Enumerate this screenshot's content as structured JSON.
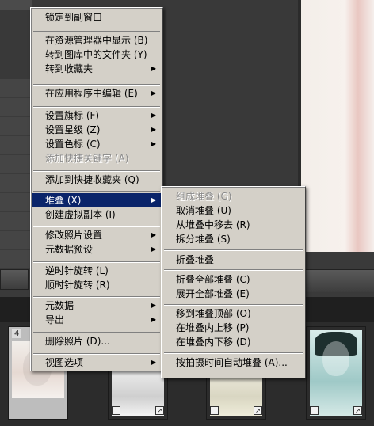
{
  "filmstrip": {
    "selected_index": "4"
  },
  "context_menu": {
    "items": [
      {
        "label": "锁定到副窗口",
        "has_submenu": false,
        "enabled": true
      },
      {
        "label": "在资源管理器中显示 (B)",
        "has_submenu": false,
        "enabled": true
      },
      {
        "label": "转到图库中的文件夹 (Y)",
        "has_submenu": false,
        "enabled": true
      },
      {
        "label": "转到收藏夹",
        "has_submenu": true,
        "enabled": true
      },
      {
        "label": "在应用程序中编辑 (E)",
        "has_submenu": true,
        "enabled": true
      },
      {
        "label": "设置旗标 (F)",
        "has_submenu": true,
        "enabled": true
      },
      {
        "label": "设置星级 (Z)",
        "has_submenu": true,
        "enabled": true
      },
      {
        "label": "设置色标 (C)",
        "has_submenu": true,
        "enabled": true
      },
      {
        "label": "添加快捷关键字 (A)",
        "has_submenu": false,
        "enabled": false
      },
      {
        "label": "添加到快捷收藏夹 (Q)",
        "has_submenu": false,
        "enabled": true
      },
      {
        "label": "堆叠 (X)",
        "has_submenu": true,
        "enabled": true,
        "selected": true
      },
      {
        "label": "创建虚拟副本 (I)",
        "has_submenu": false,
        "enabled": true
      },
      {
        "label": "修改照片设置",
        "has_submenu": true,
        "enabled": true
      },
      {
        "label": "元数据预设",
        "has_submenu": true,
        "enabled": true
      },
      {
        "label": "逆时针旋转 (L)",
        "has_submenu": false,
        "enabled": true
      },
      {
        "label": "顺时针旋转 (R)",
        "has_submenu": false,
        "enabled": true
      },
      {
        "label": "元数据",
        "has_submenu": true,
        "enabled": true
      },
      {
        "label": "导出",
        "has_submenu": true,
        "enabled": true
      },
      {
        "label": "删除照片 (D)...",
        "has_submenu": false,
        "enabled": true
      },
      {
        "label": "视图选项",
        "has_submenu": true,
        "enabled": true
      }
    ]
  },
  "stack_submenu": {
    "items": [
      {
        "label": "组成堆叠 (G)",
        "enabled": false
      },
      {
        "label": "取消堆叠 (U)",
        "enabled": true
      },
      {
        "label": "从堆叠中移去 (R)",
        "enabled": true
      },
      {
        "label": "拆分堆叠 (S)",
        "enabled": true
      },
      {
        "label": "折叠堆叠",
        "enabled": true
      },
      {
        "label": "折叠全部堆叠 (C)",
        "enabled": true
      },
      {
        "label": "展开全部堆叠 (E)",
        "enabled": true
      },
      {
        "label": "移到堆叠顶部 (O)",
        "enabled": true
      },
      {
        "label": "在堆叠内上移 (P)",
        "enabled": true
      },
      {
        "label": "在堆叠内下移 (D)",
        "enabled": true
      },
      {
        "label": "按拍摄时间自动堆叠 (A)...",
        "enabled": true
      }
    ]
  },
  "colors": {
    "menu_bg": "#d4d0c8",
    "highlight": "#0a246a",
    "highlight_text": "#ffffff",
    "disabled_text": "#8a8a8a"
  }
}
